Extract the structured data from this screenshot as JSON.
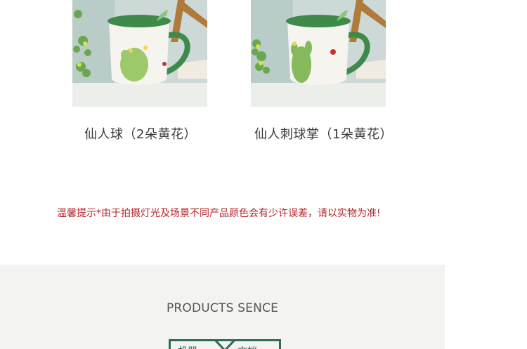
{
  "products": [
    {
      "caption": "仙人球（2朵黄花）"
    },
    {
      "caption": "仙人刺球掌（1朵黄花）"
    }
  ],
  "notice": "温馨提示*由于拍摄灯光及场景不同产品颜色会有少许误差，请以实物为准!",
  "sence": {
    "title": "PRODUCTS SENCE",
    "tab_left": "机器",
    "tab_right": "文档"
  },
  "colors": {
    "notice": "#b3262b",
    "accent_green": "#2f6b57",
    "panel_bg": "#f3f3f2"
  }
}
